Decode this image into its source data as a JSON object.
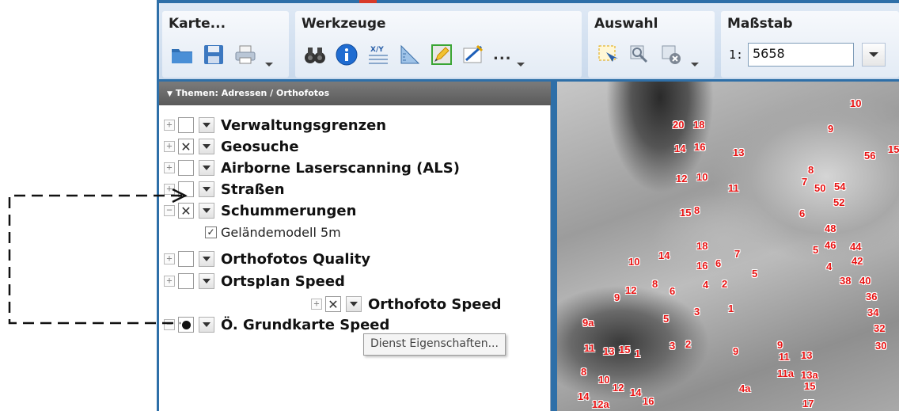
{
  "toolbar": {
    "groups": [
      {
        "title": "Karte...",
        "icons": [
          "folder-icon",
          "save-icon",
          "print-icon"
        ]
      },
      {
        "title": "Werkzeuge",
        "icons": [
          "binoculars-icon",
          "info-icon",
          "xy-coordinates-icon",
          "measure-area-icon",
          "edit-icon",
          "draw-line-icon"
        ],
        "more": "..."
      },
      {
        "title": "Auswahl",
        "icons": [
          "select-rectangle-icon",
          "zoom-select-icon",
          "clear-selection-icon"
        ]
      },
      {
        "title": "Maßstab",
        "scale_prefix": "1:",
        "scale_value": "5658"
      }
    ]
  },
  "panel": {
    "header": "Themen: Adressen / Orthofotos",
    "layers": [
      {
        "label": "Verwaltungsgrenzen",
        "checked": false,
        "expand": "+"
      },
      {
        "label": "Geosuche",
        "checked": true,
        "expand": "+"
      },
      {
        "label": "Airborne Laserscanning (ALS)",
        "checked": false,
        "expand": "+"
      },
      {
        "label": "Straßen",
        "checked": false,
        "expand": "+"
      },
      {
        "label": "Schummerungen",
        "checked": true,
        "expand": "−"
      },
      {
        "label": "Geländemodell 5m",
        "checked": true,
        "sub": true
      },
      {
        "label": "Orthofotos Quality",
        "checked": false,
        "expand": "+"
      },
      {
        "label": "Ortsplan Speed",
        "checked": false,
        "expand": "+"
      },
      {
        "label": "Orthofoto Speed",
        "checked": true,
        "expand": "+",
        "dragging": true
      },
      {
        "label": "Ö. Grundkarte Speed",
        "checked": "dot",
        "expand": "−"
      }
    ],
    "tooltip": "Dienst Eigenschaften..."
  },
  "map": {
    "labels": [
      "10",
      "20",
      "18",
      "9",
      "14",
      "16",
      "13",
      "56",
      "15",
      "8",
      "12",
      "10",
      "11",
      "7",
      "50",
      "54",
      "52",
      "15",
      "8",
      "6",
      "48",
      "5",
      "46",
      "44",
      "10",
      "14",
      "18",
      "16",
      "6",
      "7",
      "42",
      "4",
      "38",
      "40",
      "9",
      "12",
      "8",
      "6",
      "4",
      "2",
      "5",
      "36",
      "3",
      "1",
      "9a",
      "5",
      "34",
      "32",
      "9",
      "11",
      "13",
      "15",
      "1",
      "3",
      "2",
      "9",
      "11",
      "13",
      "30",
      "8",
      "10",
      "12",
      "14",
      "16",
      "4a",
      "11a",
      "13a",
      "15",
      "14",
      "12a",
      "17"
    ]
  }
}
